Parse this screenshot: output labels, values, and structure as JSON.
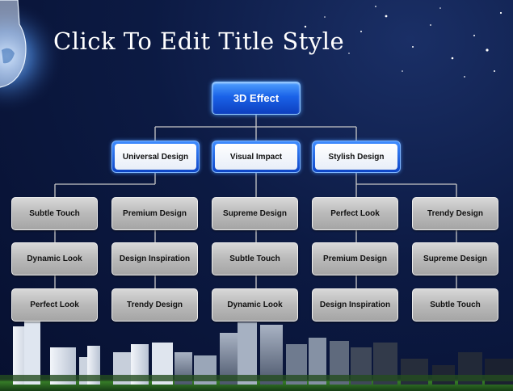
{
  "slide": {
    "title": "Click To Edit Title Style"
  },
  "diagram": {
    "root": "3D Effect",
    "branches": [
      {
        "label": "Universal Design",
        "columns": [
          [
            "Subtle Touch",
            "Dynamic Look",
            "Perfect Look"
          ],
          [
            "Premium Design",
            "Design Inspiration",
            "Trendy Design"
          ]
        ]
      },
      {
        "label": "Visual Impact",
        "columns": [
          [
            "Supreme Design",
            "Subtle Touch",
            "Dynamic Look"
          ]
        ]
      },
      {
        "label": "Stylish Design",
        "columns": [
          [
            "Perfect Look",
            "Premium Design",
            "Design Inspiration"
          ],
          [
            "Trendy Design",
            "Supreme Design",
            "Subtle Touch"
          ]
        ]
      }
    ]
  },
  "colors": {
    "background": "#0c1a43",
    "root_fill": "#1a62e8",
    "branch_fill": "#0e45c6",
    "leaf_fill": "#b9b9b9",
    "connector": "#c8c8c8"
  },
  "decor": {
    "icons": [
      "light-bulb-icon",
      "city-skyline-icon",
      "star-icon"
    ]
  }
}
